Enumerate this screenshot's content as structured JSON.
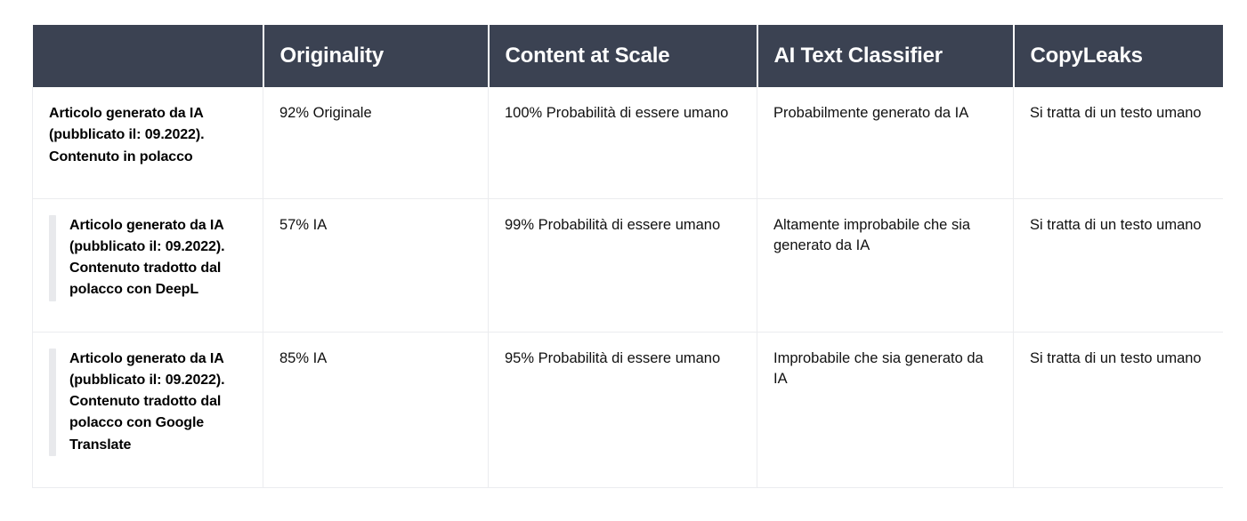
{
  "table": {
    "headers": [
      {
        "key": "row_label",
        "label": ""
      },
      {
        "key": "originality",
        "label": "Originality"
      },
      {
        "key": "content_at_scale",
        "label": "Content at Scale"
      },
      {
        "key": "ai_text_classifier",
        "label": "AI Text Classifier"
      },
      {
        "key": "copyleaks",
        "label": "CopyLeaks"
      }
    ],
    "header_bg": "#3b4252",
    "header_text_color": "#ffffff",
    "grid_line_color": "#ebecef",
    "indent_bar_color": "#e8e9ec",
    "rows": [
      {
        "indented": false,
        "label": "Articolo generato da IA (pubblicato il: 09.2022). Contenuto in polacco",
        "originality": "92% Originale",
        "content_at_scale": "100% Probabilità di essere umano",
        "ai_text_classifier": "Probabilmente generato da IA",
        "copyleaks": "Si tratta di un testo umano"
      },
      {
        "indented": true,
        "label": "Articolo generato da IA (pubblicato il: 09.2022). Contenuto tradotto dal polacco con DeepL",
        "originality": "57% IA",
        "content_at_scale": "99% Probabilità di essere umano",
        "ai_text_classifier": "Altamente improbabile che sia generato da IA",
        "copyleaks": "Si tratta di un testo umano"
      },
      {
        "indented": true,
        "label": "Articolo generato da IA (pubblicato il: 09.2022). Contenuto tradotto dal polacco con Google Translate",
        "originality": "85% IA",
        "content_at_scale": "95% Probabilità di essere umano",
        "ai_text_classifier": "Improbabile che sia generato da IA",
        "copyleaks": "Si tratta di un testo umano"
      }
    ]
  }
}
